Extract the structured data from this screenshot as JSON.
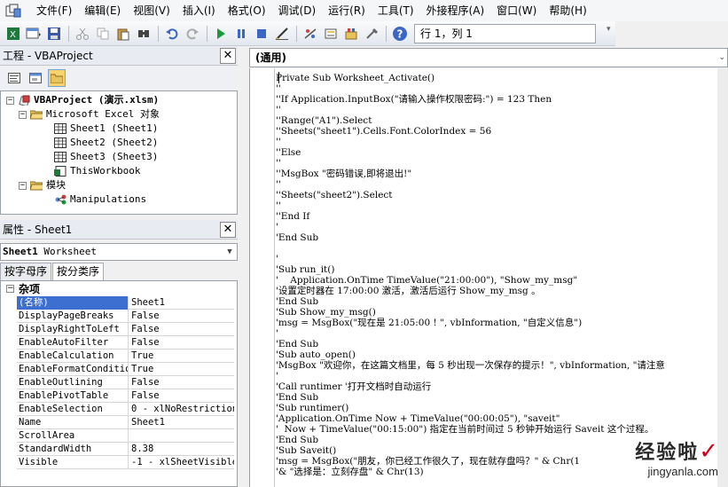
{
  "menu": [
    "文件(F)",
    "编辑(E)",
    "视图(V)",
    "插入(I)",
    "格式(O)",
    "调试(D)",
    "运行(R)",
    "工具(T)",
    "外接程序(A)",
    "窗口(W)",
    "帮助(H)"
  ],
  "toolbar": {
    "position_text": "行 1，列 1",
    "icons": [
      "excel-icon",
      "insert-userform-icon",
      "save-icon",
      "cut-icon",
      "copy-icon",
      "paste-icon",
      "find-icon",
      "undo-icon",
      "redo-icon",
      "run-icon",
      "break-icon",
      "reset-icon",
      "design-mode-icon",
      "project-explorer-icon",
      "properties-icon",
      "object-browser-icon",
      "toolbox-icon",
      "help-icon"
    ]
  },
  "project": {
    "title": "工程 - VBAProject",
    "tree": {
      "root": "VBAProject (演示.xlsm)",
      "excel_objects_folder": "Microsoft Excel 对象",
      "sheets": [
        "Sheet1 (Sheet1)",
        "Sheet2 (Sheet2)",
        "Sheet3 (Sheet3)"
      ],
      "workbook": "ThisWorkbook",
      "modules_folder": "模块",
      "modules": [
        "Manipulations"
      ]
    }
  },
  "properties": {
    "title": "属性 - Sheet1",
    "object_name": "Sheet1",
    "object_type": "Worksheet",
    "tabs": [
      "按字母序",
      "按分类序"
    ],
    "active_tab": 1,
    "category": "杂项",
    "rows": [
      {
        "name": "(名称)",
        "value": "Sheet1"
      },
      {
        "name": "DisplayPageBreaks",
        "value": "False"
      },
      {
        "name": "DisplayRightToLeft",
        "value": "False"
      },
      {
        "name": "EnableAutoFilter",
        "value": "False"
      },
      {
        "name": "EnableCalculation",
        "value": "True"
      },
      {
        "name": "EnableFormatConditions",
        "value": "True"
      },
      {
        "name": "EnableOutlining",
        "value": "False"
      },
      {
        "name": "EnablePivotTable",
        "value": "False"
      },
      {
        "name": "EnableSelection",
        "value": "0 - xlNoRestrictions"
      },
      {
        "name": "Name",
        "value": "Sheet1"
      },
      {
        "name": "ScrollArea",
        "value": ""
      },
      {
        "name": "StandardWidth",
        "value": "8.38"
      },
      {
        "name": "Visible",
        "value": "-1 - xlSheetVisible"
      }
    ]
  },
  "code": {
    "object_combo": "(通用)",
    "lines": [
      {
        "text": "Private Sub Worksheet_Activate()",
        "comment": false
      },
      {
        "text": "''",
        "comment": false
      },
      {
        "text": "''If Application.InputBox(\"请输入操作权限密码:\") = 123 Then",
        "comment": false
      },
      {
        "text": "''",
        "comment": false
      },
      {
        "text": "''Range(\"A1\").Select",
        "comment": false
      },
      {
        "text": "''Sheets(\"sheet1\").Cells.Font.ColorIndex = 56",
        "comment": false
      },
      {
        "text": "''",
        "comment": false
      },
      {
        "text": "''Else",
        "comment": false
      },
      {
        "text": "''",
        "comment": false
      },
      {
        "text": "''MsgBox \"密码错误,即将退出!\"",
        "comment": false
      },
      {
        "text": "''",
        "comment": false
      },
      {
        "text": "''Sheets(\"sheet2\").Select",
        "comment": false
      },
      {
        "text": "''",
        "comment": false
      },
      {
        "text": "''End If",
        "comment": false
      },
      {
        "text": "'",
        "comment": false
      },
      {
        "text": "'End Sub",
        "comment": false
      },
      {
        "text": "",
        "comment": false
      },
      {
        "text": "'",
        "comment": false
      },
      {
        "text": "'Sub run_it()",
        "comment": false
      },
      {
        "text": "'    Application.OnTime TimeValue(\"21:00:00\"), \"Show_my_msg\"",
        "comment": false
      },
      {
        "text": "'设置定时器在 17:00:00 激活，激活后运行 Show_my_msg 。",
        "comment": false
      },
      {
        "text": "'End Sub",
        "comment": false
      },
      {
        "text": "'Sub Show_my_msg()",
        "comment": false
      },
      {
        "text": "'msg = MsgBox(\"现在是 21:05:00 ! \", vbInformation, \"自定义信息\")",
        "comment": false
      },
      {
        "text": "'",
        "comment": false
      },
      {
        "text": "'End Sub",
        "comment": false
      },
      {
        "text": "'Sub auto_open()",
        "comment": false
      },
      {
        "text": "'MsgBox \"欢迎你，在这篇文档里，每 5 秒出现一次保存的提示！\", vbInformation, \"请注意",
        "comment": false
      },
      {
        "text": "'",
        "comment": false
      },
      {
        "text": "'Call runtimer '打开文档时自动运行",
        "comment": false
      },
      {
        "text": "'End Sub",
        "comment": false
      },
      {
        "text": "'Sub runtimer()",
        "comment": false
      },
      {
        "text": "'Application.OnTime Now + TimeValue(\"00:00:05\"), \"saveit\"",
        "comment": false
      },
      {
        "text": "'  Now + TimeValue(\"00:15:00\") 指定在当前时间过 5 秒钟开始运行 Saveit 这个过程。",
        "comment": false
      },
      {
        "text": "'End Sub",
        "comment": false
      },
      {
        "text": "'Sub Saveit()",
        "comment": false
      },
      {
        "text": "'msg = MsgBox(\"朋友，你已经工作很久了，现在就存盘吗？\" & Chr(1",
        "comment": false
      },
      {
        "text": "'& \"选择是：立刻存盘\" & Chr(13)",
        "comment": false
      }
    ]
  },
  "watermark": {
    "brand": "经验啦",
    "url": "jingyanla.com"
  },
  "colors": {
    "selection": "#3d6fd0",
    "folder": "#e8c25a",
    "run": "#1a9a3a"
  }
}
